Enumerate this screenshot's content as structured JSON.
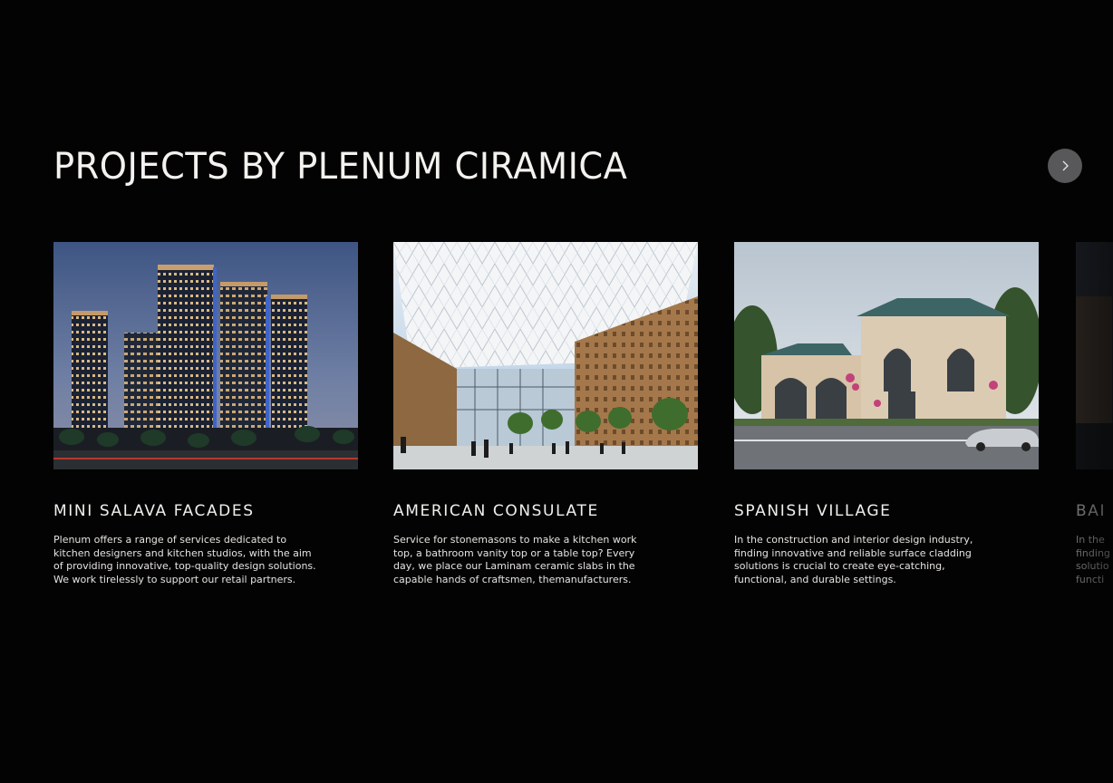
{
  "section": {
    "title": "PROJECTS BY PLENUM CIRAMICA"
  },
  "carousel": {
    "next_icon": "chevron-right-icon",
    "cards": [
      {
        "title": "MINI SALAVA FACADES",
        "description": "Plenum offers a range of services dedicated to kitchen designers and kitchen studios, with the aim of providing innovative, top-quality design solutions.  We work tirelessly to support our retail partners.",
        "image": "residential-towers-night-photo"
      },
      {
        "title": "AMERICAN CONSULATE",
        "description": "Service for stonemasons to make a kitchen work top, a bathroom vanity top or a table top? Every day, we place our Laminam ceramic slabs in the capable hands of craftsmen, themanufacturers.",
        "image": "atrium-glass-canopy-photo"
      },
      {
        "title": "SPANISH VILLAGE",
        "description": "In the construction and interior design industry, finding innovative and reliable surface cladding solutions is crucial to create eye-catching, functional, and durable settings.",
        "image": "villa-house-photo"
      },
      {
        "title": "BAI",
        "description": "In the finding solutio functi",
        "image": "partial-building-photo"
      }
    ]
  },
  "colors": {
    "background": "#030303",
    "button": "#58585a",
    "text": "#ffffff"
  }
}
